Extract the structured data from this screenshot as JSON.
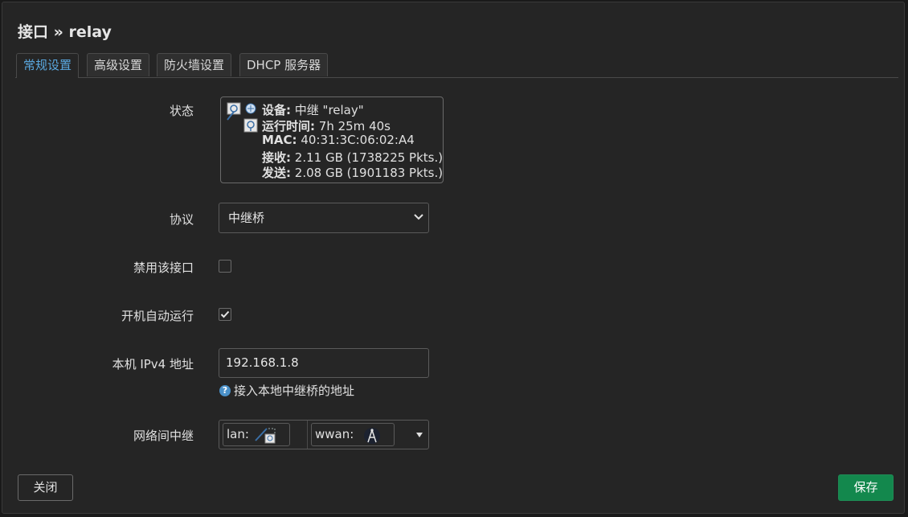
{
  "title": "接口 » relay",
  "tabs": [
    {
      "label": "常规设置",
      "active": true
    },
    {
      "label": "高级设置",
      "active": false
    },
    {
      "label": "防火墙设置",
      "active": false
    },
    {
      "label": "DHCP 服务器",
      "active": false
    }
  ],
  "status": {
    "label": "状态",
    "device_key": "设备:",
    "device_val": "中继 \"relay\"",
    "uptime_key": "运行时间:",
    "uptime_val": "7h 25m 40s",
    "mac_key": "MAC:",
    "mac_val": "40:31:3C:06:02:A4",
    "rx_key": "接收:",
    "rx_val": "2.11 GB (1738225 Pkts.)",
    "tx_key": "发送:",
    "tx_val": "2.08 GB (1901183 Pkts.)"
  },
  "protocol": {
    "label": "协议",
    "value": "中继桥"
  },
  "disable_iface": {
    "label": "禁用该接口",
    "checked": false
  },
  "autostart": {
    "label": "开机自动运行",
    "checked": true
  },
  "ipv4": {
    "label": "本机 IPv4 地址",
    "value": "192.168.1.8",
    "hint": "接入本地中继桥的地址"
  },
  "relay_between": {
    "label": "网络间中继",
    "chips": [
      {
        "label": "lan:"
      },
      {
        "label": "wwan:"
      }
    ]
  },
  "buttons": {
    "close": "关闭",
    "save": "保存"
  },
  "colors": {
    "accent": "#5aa8e0",
    "save": "#13884d",
    "help": "#4a90c8"
  }
}
